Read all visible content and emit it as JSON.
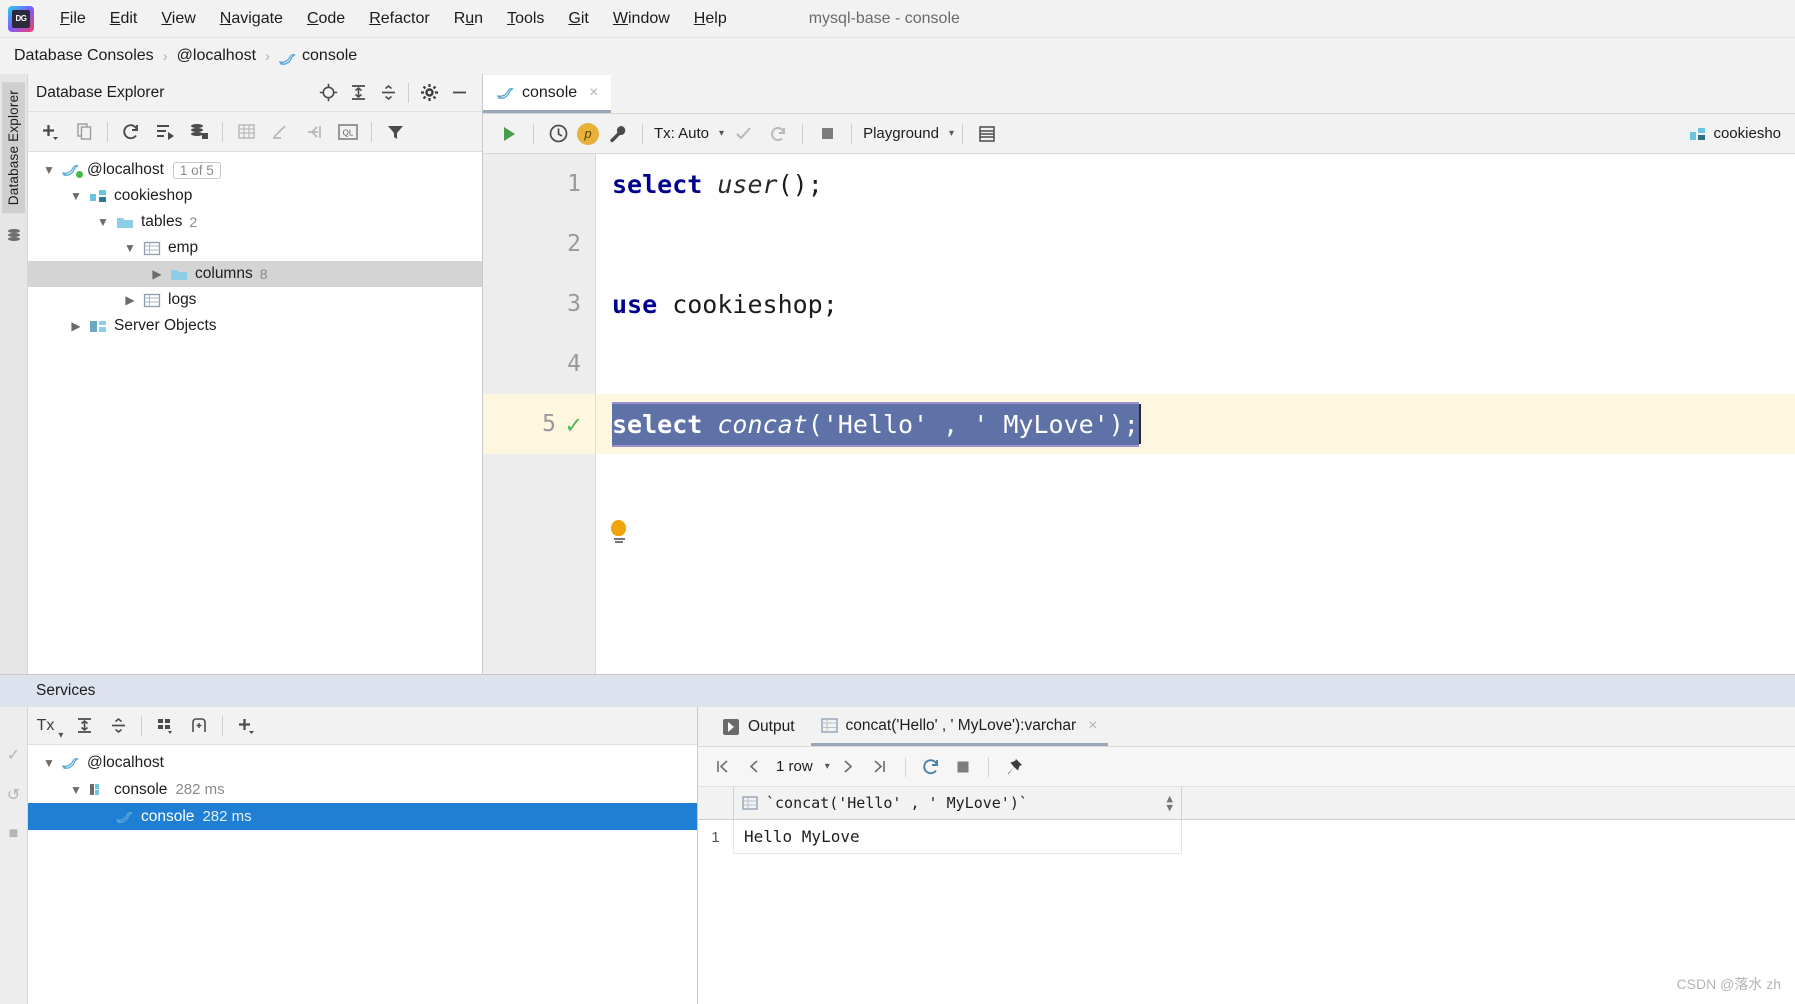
{
  "window": {
    "title": "mysql-base - console"
  },
  "menu": {
    "items": [
      {
        "label": "File",
        "mnemonic": "F"
      },
      {
        "label": "Edit",
        "mnemonic": "E"
      },
      {
        "label": "View",
        "mnemonic": "V"
      },
      {
        "label": "Navigate",
        "mnemonic": "N"
      },
      {
        "label": "Code",
        "mnemonic": "C"
      },
      {
        "label": "Refactor",
        "mnemonic": "R"
      },
      {
        "label": "Run",
        "mnemonic": "u"
      },
      {
        "label": "Tools",
        "mnemonic": "T"
      },
      {
        "label": "Git",
        "mnemonic": "G"
      },
      {
        "label": "Window",
        "mnemonic": "W"
      },
      {
        "label": "Help",
        "mnemonic": "H"
      }
    ]
  },
  "breadcrumb": {
    "items": [
      "Database Consoles",
      "@localhost",
      "console"
    ],
    "separator": "›"
  },
  "left_strip": {
    "vertical_tab": "Database Explorer"
  },
  "explorer": {
    "title": "Database Explorer",
    "header_icons": [
      "locate-icon",
      "expand-all-icon",
      "collapse-all-icon",
      "settings-gear-icon",
      "hide-icon"
    ],
    "toolbar_icons": [
      "add-icon",
      "duplicate-icon",
      "refresh-icon",
      "run-sql-script-icon",
      "db-tools-icon",
      "data-editor-icon",
      "modify-icon",
      "jump-to-icon",
      "query-console-icon",
      "filter-icon"
    ],
    "tree": [
      {
        "label": "@localhost",
        "badge": "1 of 5",
        "icon": "mysql-dolphin-icon",
        "indent": 0,
        "expanded": true,
        "selected": false
      },
      {
        "label": "cookieshop",
        "badge": "",
        "icon": "schema-icon",
        "indent": 1,
        "expanded": true,
        "selected": false
      },
      {
        "label": "tables",
        "badge": "2",
        "icon": "folder-icon",
        "indent": 2,
        "expanded": true,
        "selected": false
      },
      {
        "label": "emp",
        "badge": "",
        "icon": "table-icon",
        "indent": 3,
        "expanded": true,
        "selected": false
      },
      {
        "label": "columns",
        "badge": "8",
        "icon": "folder-icon",
        "indent": 4,
        "expanded": false,
        "selected": true
      },
      {
        "label": "logs",
        "badge": "",
        "icon": "table-icon",
        "indent": 3,
        "expanded": false,
        "selected": false
      },
      {
        "label": "Server Objects",
        "badge": "",
        "icon": "server-objects-icon",
        "indent": 1,
        "expanded": false,
        "selected": false
      }
    ]
  },
  "editor": {
    "tab": {
      "label": "console",
      "icon": "mysql-dolphin-icon",
      "close": "×"
    },
    "toolbar": {
      "run_icon": "run-play-icon",
      "history_icon": "query-history-icon",
      "profile_badge": "p",
      "wrench_icon": "wrench-icon",
      "tx_label": "Tx: Auto",
      "commit_icon": "commit-check-icon",
      "rollback_icon": "rollback-icon",
      "stop_icon": "stop-icon",
      "schema_label": "Playground",
      "table_icon": "db-table-icon",
      "right_chip": "cookiesho"
    },
    "lines": [
      {
        "number": "1",
        "tokens": [
          {
            "t": "select",
            "c": "kw"
          },
          {
            "t": " ",
            "c": "plain"
          },
          {
            "t": "user",
            "c": "fn"
          },
          {
            "t": "();",
            "c": "plain"
          }
        ],
        "current": false,
        "check": false
      },
      {
        "number": "2",
        "tokens": [],
        "current": false,
        "check": false
      },
      {
        "number": "3",
        "tokens": [
          {
            "t": "use",
            "c": "kw"
          },
          {
            "t": " cookieshop;",
            "c": "plain"
          }
        ],
        "current": false,
        "check": false
      },
      {
        "number": "4",
        "tokens": [],
        "current": false,
        "check": false
      },
      {
        "number": "5",
        "tokens": [
          {
            "t": "select",
            "c": "kw"
          },
          {
            "t": " ",
            "c": "plain"
          },
          {
            "t": "concat",
            "c": "fn"
          },
          {
            "t": "(",
            "c": "plain"
          },
          {
            "t": "'Hello'",
            "c": "str"
          },
          {
            "t": " , ",
            "c": "plain"
          },
          {
            "t": "' MyLove'",
            "c": "str"
          },
          {
            "t": ");",
            "c": "plain"
          }
        ],
        "current": true,
        "check": true,
        "selected": true
      }
    ],
    "intention_bulb": "lightbulb-icon"
  },
  "services": {
    "title": "Services",
    "rail_icons": [
      "tx-icon",
      "commit-icon",
      "rollback-icon",
      "stop-icon"
    ],
    "toolbar": {
      "tx_label": "Tx",
      "icons": [
        "expand-all-icon",
        "collapse-all-icon",
        "group-icon",
        "new-tab-icon",
        "add-icon"
      ]
    },
    "tree": [
      {
        "label": "@localhost",
        "time": "",
        "icon": "mysql-dolphin-icon",
        "indent": 0,
        "expanded": true,
        "selected": false
      },
      {
        "label": "console",
        "time": "282 ms",
        "icon": "console-icon",
        "indent": 1,
        "expanded": true,
        "selected": false
      },
      {
        "label": "console",
        "time": "282 ms",
        "icon": "mysql-dolphin-icon",
        "indent": 2,
        "expanded": false,
        "selected": true
      }
    ]
  },
  "results": {
    "tabs": [
      {
        "label": "Output",
        "icon": "output-icon",
        "active": false,
        "closable": false
      },
      {
        "label": "concat('Hello' , ' MyLove'):varchar",
        "icon": "grid-table-icon",
        "active": true,
        "closable": true,
        "close": "×"
      }
    ],
    "toolbar": {
      "first_icon": "first-page-icon",
      "prev_icon": "prev-page-icon",
      "row_count": "1 row",
      "next_icon": "next-page-icon",
      "last_icon": "last-page-icon",
      "refresh_icon": "refresh-icon",
      "stop_icon": "stop-icon",
      "pin_icon": "pin-icon"
    },
    "grid": {
      "columns": [
        "`concat('Hello' , ' MyLove')`"
      ],
      "rows": [
        {
          "num": "1",
          "cells": [
            "Hello MyLove"
          ]
        }
      ]
    }
  },
  "watermark": {
    "text": "CSDN @落水 zh"
  },
  "colors": {
    "accent_blue": "#1e7fd4",
    "selection_navy": "#5e72a8",
    "keyword_blue": "#00008f",
    "current_line": "#fdf7e0",
    "green_check": "#4eb750",
    "panel_bg": "#f2f2f2"
  }
}
